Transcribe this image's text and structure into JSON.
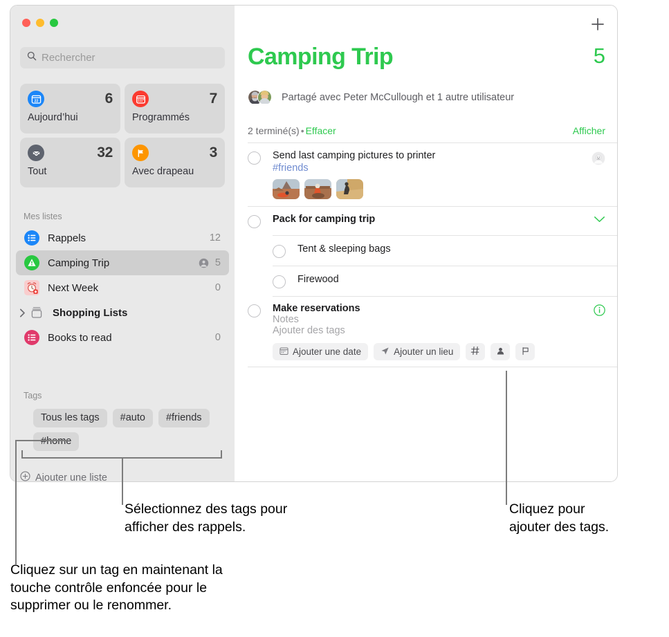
{
  "window": {
    "traffic_lights": [
      "close",
      "minimize",
      "zoom"
    ]
  },
  "search": {
    "placeholder": "Rechercher",
    "value": "",
    "icon": "search-icon"
  },
  "smart_lists": [
    {
      "label": "Aujourd’hui",
      "count": "6",
      "icon": "calendar-today-icon",
      "color": "#1b86f8",
      "glyph": "22"
    },
    {
      "label": "Programmés",
      "count": "7",
      "icon": "calendar-scheduled-icon",
      "color": "#fb3b30",
      "glyph": ""
    },
    {
      "label": "Tout",
      "count": "32",
      "icon": "inbox-all-icon",
      "color": "#5e636e",
      "glyph": ""
    },
    {
      "label": "Avec drapeau",
      "count": "3",
      "icon": "flag-icon",
      "color": "#fd9500",
      "glyph": ""
    }
  ],
  "sidebar": {
    "lists_header": "Mes listes",
    "lists": [
      {
        "name": "Rappels",
        "count": "12",
        "icon": "list-icon",
        "color": "#1b86f8",
        "selected": false,
        "bold": false,
        "shared": false,
        "group": false
      },
      {
        "name": "Camping Trip",
        "count": "5",
        "icon": "triangle-warning-icon",
        "color": "#28c840",
        "selected": true,
        "bold": false,
        "shared": true,
        "group": false
      },
      {
        "name": "Next Week",
        "count": "0",
        "icon": "alarm-clock-icon",
        "color": "#f7c7c7",
        "selected": false,
        "bold": false,
        "shared": false,
        "group": false
      },
      {
        "name": "Shopping Lists",
        "count": "",
        "icon": "folder-group-icon",
        "color": "#8a8a8e",
        "selected": false,
        "bold": true,
        "shared": false,
        "group": true
      },
      {
        "name": "Books to read",
        "count": "0",
        "icon": "list-icon",
        "color": "#e03a6b",
        "selected": false,
        "bold": false,
        "shared": false,
        "group": false
      }
    ],
    "tags_header": "Tags",
    "tags": [
      "Tous les tags",
      "#auto",
      "#friends",
      "#home"
    ],
    "add_list": {
      "label": "Ajouter une liste",
      "icon": "plus-circle-icon"
    }
  },
  "main": {
    "add_button_icon": "plus-icon",
    "title": "Camping Trip",
    "count": "5",
    "shared_with": "Partagé avec Peter McCullough et 1 autre utilisateur",
    "completed_text": "2 terminé(s)",
    "separator": "•",
    "clear_label": "Effacer",
    "show_label": "Afficher",
    "accent_color": "#2ec94f"
  },
  "tasks": [
    {
      "title": "Send last camping pictures to printer",
      "tag": "#friends",
      "bold": false,
      "has_photos": true,
      "photo_count": 3,
      "right_icon": "assigned-avatar-icon",
      "subtasks": []
    },
    {
      "title": "Pack for camping trip",
      "bold": true,
      "right_icon": "chevron-down-icon",
      "subtasks": [
        {
          "title": "Tent & sleeping bags"
        },
        {
          "title": "Firewood"
        }
      ]
    },
    {
      "title": "Make reservations",
      "bold": true,
      "notes_placeholder": "Notes",
      "tags_placeholder": "Ajouter des tags",
      "right_icon": "info-circle-icon",
      "chips": [
        {
          "label": "Ajouter une date",
          "icon": "calendar-icon",
          "square": false
        },
        {
          "label": "Ajouter un lieu",
          "icon": "location-arrow-icon",
          "square": false
        },
        {
          "label": "",
          "icon": "hash-tag-icon",
          "square": true
        },
        {
          "label": "",
          "icon": "person-icon",
          "square": true
        },
        {
          "label": "",
          "icon": "flag-outline-icon",
          "square": true
        }
      ]
    }
  ],
  "callouts": [
    {
      "id": "tags-select",
      "line1": "Sélectionnez des tags pour",
      "line2": "afficher des rappels."
    },
    {
      "id": "add-tags",
      "line1": "Cliquez pour",
      "line2": "ajouter des tags."
    },
    {
      "id": "tag-ctrl",
      "line1": "Cliquez sur un tag en maintenant la",
      "line2": "touche contrôle enfoncée pour le",
      "line3": "supprimer ou le renommer."
    }
  ]
}
